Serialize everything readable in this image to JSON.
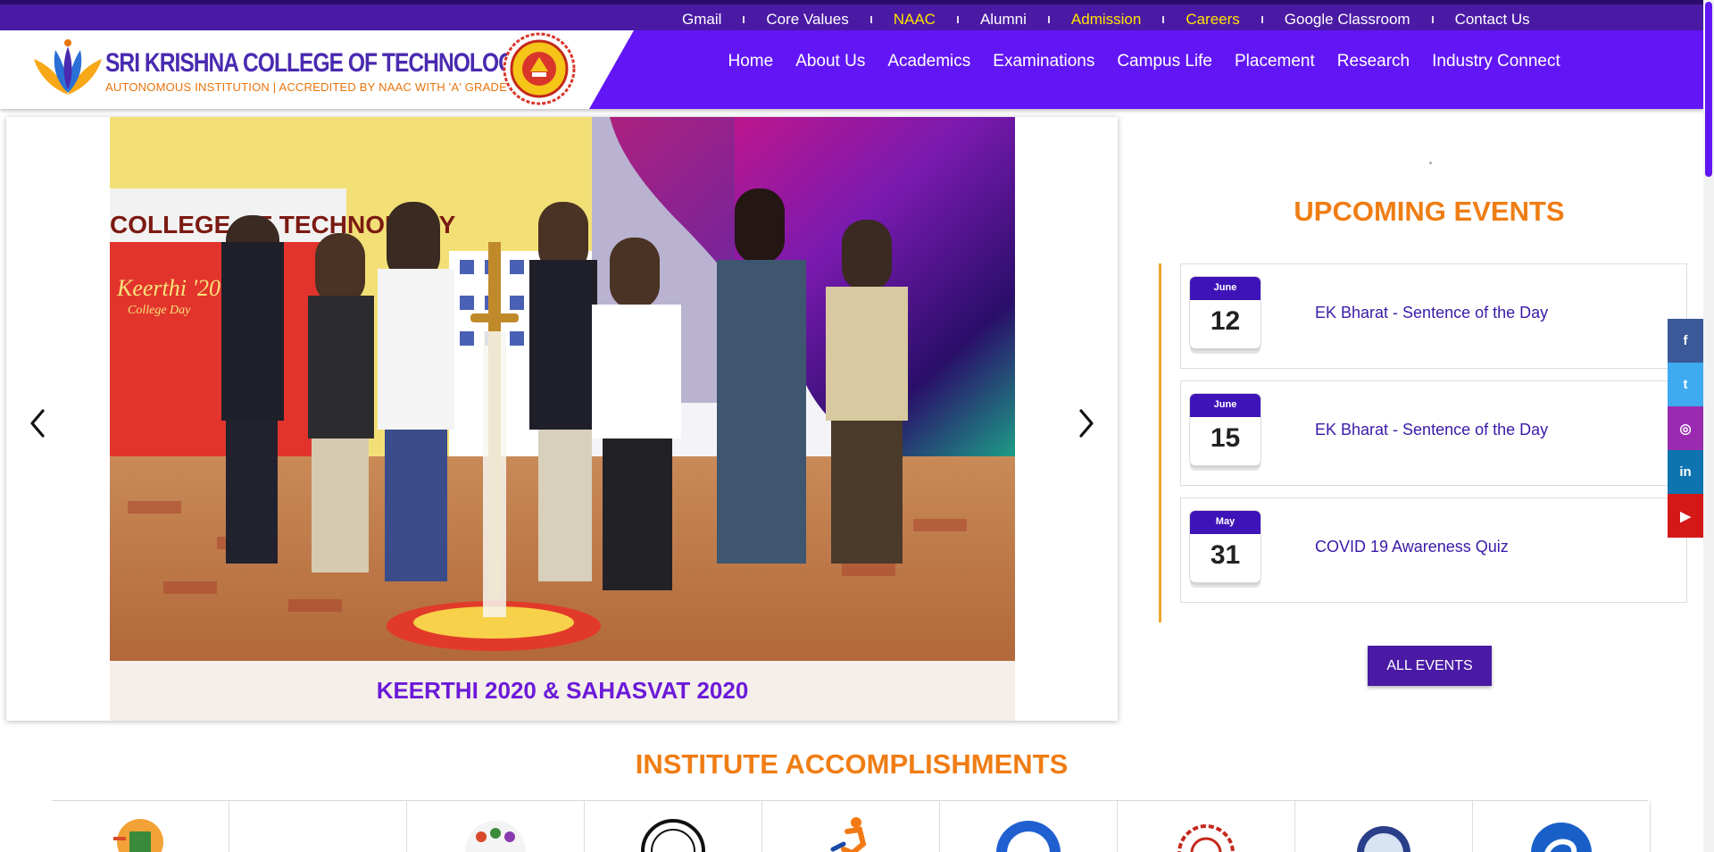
{
  "topbar": {
    "links": [
      {
        "label": "Gmail",
        "highlight": false
      },
      {
        "label": "Core Values",
        "highlight": false
      },
      {
        "label": "NAAC",
        "highlight": true
      },
      {
        "label": "Alumni",
        "highlight": false
      },
      {
        "label": "Admission",
        "highlight": true
      },
      {
        "label": "Careers",
        "highlight": true
      },
      {
        "label": "Google Classroom",
        "highlight": false
      },
      {
        "label": "Contact Us",
        "highlight": false
      }
    ]
  },
  "header": {
    "title": "SRI KRISHNA COLLEGE OF TECHNOLOGY",
    "subtitle": "AUTONOMOUS INSTITUTION | ACCREDITED BY NAAC WITH 'A' GRADE"
  },
  "nav": [
    "Home",
    "About Us",
    "Academics",
    "Examinations",
    "Campus Life",
    "Placement",
    "Research",
    "Industry Connect"
  ],
  "slider": {
    "caption": "KEERTHI 2020 & SAHASVAT 2020",
    "banner_text": "COLLEGE OF TECHNOLOGY",
    "banner_sub": "Keerthi '20",
    "banner_sub2": "College Day"
  },
  "events": {
    "title": "UPCOMING EVENTS",
    "items": [
      {
        "month": "June",
        "day": "12",
        "title": "EK Bharat - Sentence of the Day"
      },
      {
        "month": "June",
        "day": "15",
        "title": "EK Bharat - Sentence of the Day"
      },
      {
        "month": "May",
        "day": "31",
        "title": "COVID 19 Awareness Quiz"
      }
    ],
    "button": "ALL EVENTS"
  },
  "social": [
    {
      "icon": "facebook-icon",
      "glyph": "f",
      "color": "#3b5998"
    },
    {
      "icon": "twitter-icon",
      "glyph": "t",
      "color": "#3eaaf0"
    },
    {
      "icon": "instagram-icon",
      "glyph": "◎",
      "color": "#9a2bb0"
    },
    {
      "icon": "linkedin-icon",
      "glyph": "in",
      "color": "#0d74b0"
    },
    {
      "icon": "youtube-icon",
      "glyph": "▶",
      "color": "#d41818"
    }
  ],
  "accomplishments": {
    "title": "INSTITUTE ACCOMPLISHMENTS"
  },
  "colors": {
    "primary": "#6216f5",
    "topbar": "#4a1aa5",
    "accent": "#ef7d14",
    "highlight": "#ffe400"
  }
}
